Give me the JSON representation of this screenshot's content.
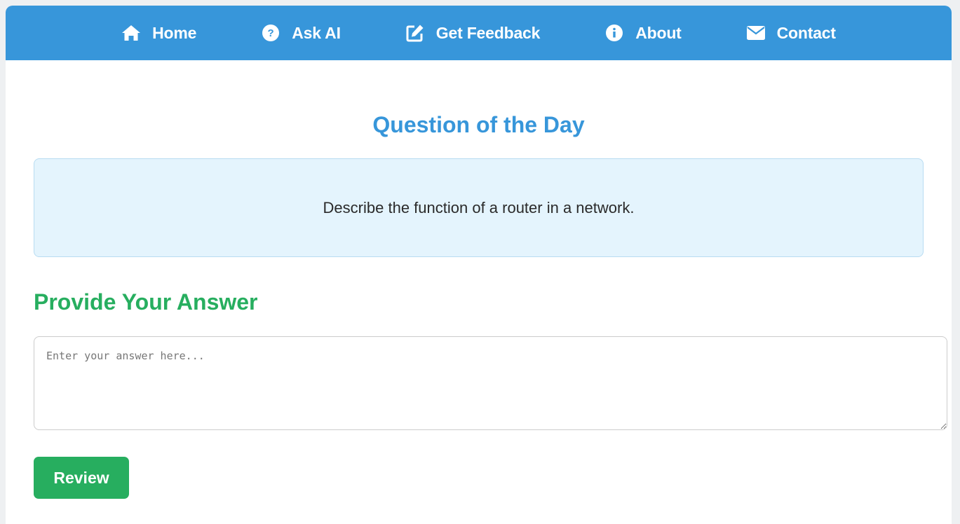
{
  "nav": {
    "items": [
      {
        "label": "Home",
        "icon": "home-icon"
      },
      {
        "label": "Ask AI",
        "icon": "question-circle-icon"
      },
      {
        "label": "Get Feedback",
        "icon": "edit-icon"
      },
      {
        "label": "About",
        "icon": "info-circle-icon"
      },
      {
        "label": "Contact",
        "icon": "envelope-icon"
      }
    ]
  },
  "main": {
    "title": "Question of the Day",
    "question": "Describe the function of a router in a network.",
    "answer_heading": "Provide Your Answer",
    "answer_placeholder": "Enter your answer here...",
    "answer_value": "",
    "review_label": "Review"
  },
  "colors": {
    "primary": "#3796da",
    "accent": "#27ae5f",
    "question_bg": "#e4f4fd"
  }
}
